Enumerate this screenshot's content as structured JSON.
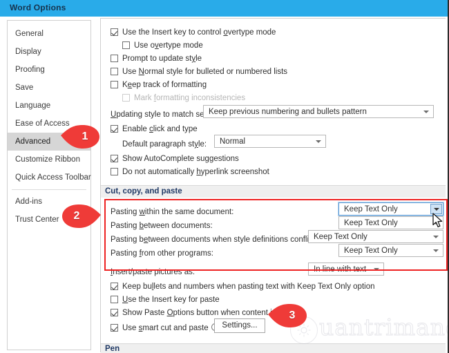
{
  "window": {
    "title": "Word Options",
    "titlebar_color": "#29abe9"
  },
  "sidebar": {
    "items": [
      {
        "label": "General",
        "selected": false
      },
      {
        "label": "Display",
        "selected": false
      },
      {
        "label": "Proofing",
        "selected": false
      },
      {
        "label": "Save",
        "selected": false
      },
      {
        "label": "Language",
        "selected": false
      },
      {
        "label": "Ease of Access",
        "selected": false
      },
      {
        "label": "Advanced",
        "selected": true
      },
      {
        "label": "Customize Ribbon",
        "selected": false
      },
      {
        "label": "Quick Access Toolbar",
        "selected": false
      },
      {
        "label": "Add-ins",
        "selected": false
      },
      {
        "label": "Trust Center",
        "selected": false
      }
    ]
  },
  "main": {
    "editing_options": [
      {
        "label_pre": "Use the Insert key to control ",
        "accel": "o",
        "label_post": "vertype mode",
        "checked": true,
        "indent": 0,
        "disabled": false
      },
      {
        "label_pre": "Use o",
        "accel": "v",
        "label_post": "ertype mode",
        "checked": false,
        "indent": 1,
        "disabled": false
      },
      {
        "label_pre": "Prompt to update st",
        "accel": "y",
        "label_post": "le",
        "checked": false,
        "indent": 0,
        "disabled": false
      },
      {
        "label_pre": "Use ",
        "accel": "N",
        "label_post": "ormal style for bulleted or numbered lists",
        "checked": false,
        "indent": 0,
        "disabled": false
      },
      {
        "label_pre": "K",
        "accel": "e",
        "label_post": "ep track of formatting",
        "checked": false,
        "indent": 0,
        "disabled": false
      },
      {
        "label_pre": "Mark ",
        "accel": "f",
        "label_post": "ormatting inconsistencies",
        "checked": false,
        "indent": 1,
        "disabled": true
      }
    ],
    "updating_style": {
      "label_pre": "",
      "accel": "U",
      "label_post": "pdating style to match selection:",
      "value": "Keep previous numbering and bullets pattern"
    },
    "enable_click_type": {
      "label_pre": "Enable ",
      "accel": "c",
      "label_post": "lick and type",
      "checked": true
    },
    "default_paragraph_style": {
      "label_pre": "Default paragraph st",
      "accel": "y",
      "label_post": "le:",
      "value": "Normal"
    },
    "autocomplete": {
      "label_pre": "Show AutoComplete suggestions",
      "accel": "",
      "label_post": "",
      "checked": true
    },
    "hyperlink_screenshot": {
      "label_pre": "Do not automatically ",
      "accel": "h",
      "label_post": "yperlink screenshot",
      "checked": false
    },
    "cut_copy_paste_section": "Cut, copy, and paste",
    "paste_rows": [
      {
        "label_pre": "Pasting ",
        "accel": "w",
        "label_post": "ithin the same document:",
        "value": "Keep Text Only",
        "focused": true
      },
      {
        "label_pre": "Pasting ",
        "accel": "b",
        "label_post": "etween documents:",
        "value": "Keep Text Only",
        "focused": false
      },
      {
        "label_pre": "Pasting b",
        "accel": "e",
        "label_post": "tween documents when style definitions conflict:",
        "value": "Keep Text Only",
        "focused": false
      },
      {
        "label_pre": "Pasting ",
        "accel": "f",
        "label_post": "rom other programs:",
        "value": "Keep Text Only",
        "focused": false
      }
    ],
    "insert_paste_pictures": {
      "label_pre": "",
      "accel": "I",
      "label_post": "nsert/paste pictures as:",
      "value": "In line with text"
    },
    "paste_checkboxes": [
      {
        "label_pre": "Keep bu",
        "accel": "l",
        "label_post": "lets and numbers when pasting text with Keep Text Only option",
        "checked": true
      },
      {
        "label_pre": "",
        "accel": "U",
        "label_post": "se the Insert key for paste",
        "checked": false
      },
      {
        "label_pre": "Show Paste ",
        "accel": "O",
        "label_post": "ptions button when content is pasted",
        "checked": true
      },
      {
        "label_pre": "Use ",
        "accel": "s",
        "label_post": "mart cut and paste",
        "checked": true
      }
    ],
    "settings_button": {
      "label_pre": "Settin",
      "accel": "g",
      "label_post": "s..."
    },
    "bottom_section": "Pen"
  },
  "callouts": [
    {
      "number": "1",
      "direction": "left"
    },
    {
      "number": "2",
      "direction": "right"
    },
    {
      "number": "3",
      "direction": "left"
    }
  ],
  "highlight": {
    "color": "#ee2222"
  },
  "watermark": {
    "text": "uantrimang"
  }
}
